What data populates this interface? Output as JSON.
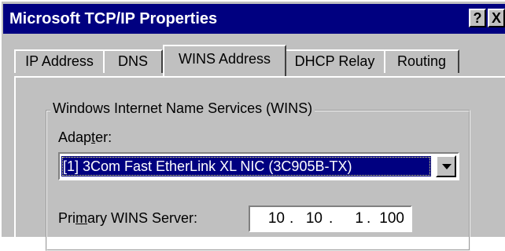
{
  "window": {
    "title": "Microsoft TCP/IP Properties",
    "help_label": "?",
    "close_label": "X"
  },
  "tabs": [
    {
      "label": "IP Address"
    },
    {
      "label": "DNS"
    },
    {
      "label": "WINS Address",
      "active": true
    },
    {
      "label": "DHCP Relay"
    },
    {
      "label": "Routing"
    }
  ],
  "wins": {
    "group_title": "Windows Internet Name Services (WINS)",
    "adapter_label_pre": "Adap",
    "adapter_label_mnemonic": "t",
    "adapter_label_post": "er:",
    "adapter_value": "[1] 3Com Fast EtherLink XL NIC (3C905B-TX)",
    "primary_label_pre": "Pri",
    "primary_label_mnemonic": "m",
    "primary_label_post": "ary WINS Server:",
    "primary_ip": {
      "o1": "10",
      "o2": "10",
      "o3": "1",
      "o4": "100"
    },
    "ip_separator": "."
  }
}
